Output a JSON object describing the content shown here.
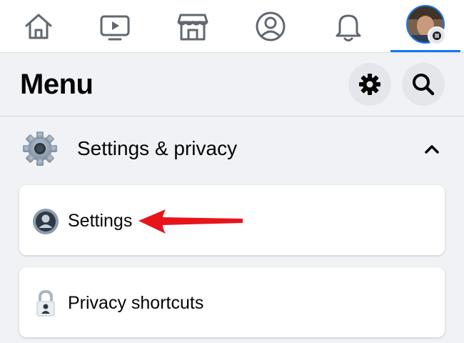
{
  "nav": {
    "tabs": [
      {
        "name": "home",
        "icon": "home-icon"
      },
      {
        "name": "watch",
        "icon": "video-icon"
      },
      {
        "name": "marketplace",
        "icon": "marketplace-icon"
      },
      {
        "name": "profile",
        "icon": "profile-icon"
      },
      {
        "name": "notifications",
        "icon": "bell-icon"
      },
      {
        "name": "menu",
        "icon": "avatar-menu-icon",
        "active": true
      }
    ]
  },
  "header": {
    "title": "Menu"
  },
  "section": {
    "label": "Settings & privacy",
    "expanded": true
  },
  "items": [
    {
      "label": "Settings",
      "icon": "user-circle-icon"
    },
    {
      "label": "Privacy shortcuts",
      "icon": "lock-icon"
    }
  ],
  "colors": {
    "accent": "#1877f2",
    "background": "#f0f2f5",
    "annotation_arrow": "#e8141c"
  }
}
